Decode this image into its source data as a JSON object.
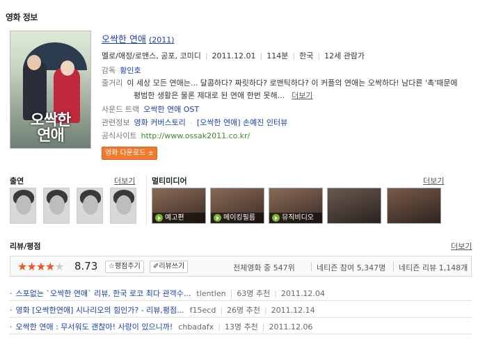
{
  "section_title": "영화 정보",
  "movie": {
    "title": "오싹한 연애",
    "year": "(2011)",
    "genre": "멜로/애정/로맨스, 공포, 코미디",
    "release": "2011.12.01",
    "runtime": "114분",
    "country": "한국",
    "rating": "12세 관람가",
    "director_label": "감독",
    "director": "황인호",
    "synopsis_label": "줄거리",
    "synopsis_line1": "이 세상 모든 연애는... 달콤하다? 짜릿하다? 로맨틱하다? 이 커플의 연애는 오싹하다! 남다른 '촉'때문에",
    "synopsis_line2": "평범한 생활은 물론 제대로 된 연애 한번 못해...",
    "synopsis_more": "더보기",
    "soundtrack_label": "사운드 트랙",
    "soundtrack": "오싹한 연애 OST",
    "related_label": "관련정보",
    "related_1": "영화 커버스토리",
    "related_2": "[오싹한 연애] 손예진 인터뷰",
    "site_label": "공식사이트",
    "site_url": "http://www.ossak2011.co.kr/",
    "download_button": "영화 다운로드 ±",
    "poster_title": "오싹한\n연애"
  },
  "cast": {
    "heading": "출연",
    "more": "더보기",
    "count": 4
  },
  "multimedia": {
    "heading": "멀티미디어",
    "more": "더보기",
    "items": [
      {
        "label": "예고편"
      },
      {
        "label": "메이킹필름"
      },
      {
        "label": "뮤직비디오"
      },
      {
        "label": ""
      },
      {
        "label": ""
      }
    ]
  },
  "review": {
    "heading": "리뷰/평점",
    "more": "더보기",
    "score": "8.73",
    "rating_fraction": 0.873,
    "rate_button": "☆평점주기",
    "write_button": "✐리뷰쓰기",
    "stat_rank": "전체영화 중 547위",
    "stat_netizen": "네티즌 참여 5,347명",
    "stat_reviews": "네티즌 리뷰 1,148개",
    "items": [
      {
        "title": "스포없는 `오싹한 연애` 리뷰, 한국 로코 최다 관객수...",
        "user": "tlentlen",
        "recommend": "63명 추천",
        "date": "2011.12.04"
      },
      {
        "title": "영화 [오싹한연애] 시나리오의 힘인가? - 리뷰,평점...",
        "user": "f15ecd",
        "recommend": "26명 추천",
        "date": "2011.12.14"
      },
      {
        "title": "오싹한 연애 : 무서워도 괜찮아! 사랑이 있으니까!",
        "user": "chbadafx",
        "recommend": "13명 추천",
        "date": "2011.12.06"
      }
    ]
  },
  "colors": {
    "link": "#1a3fae",
    "accent": "#f07a2e",
    "star": "#e8562b",
    "url": "#3a8a2a"
  }
}
